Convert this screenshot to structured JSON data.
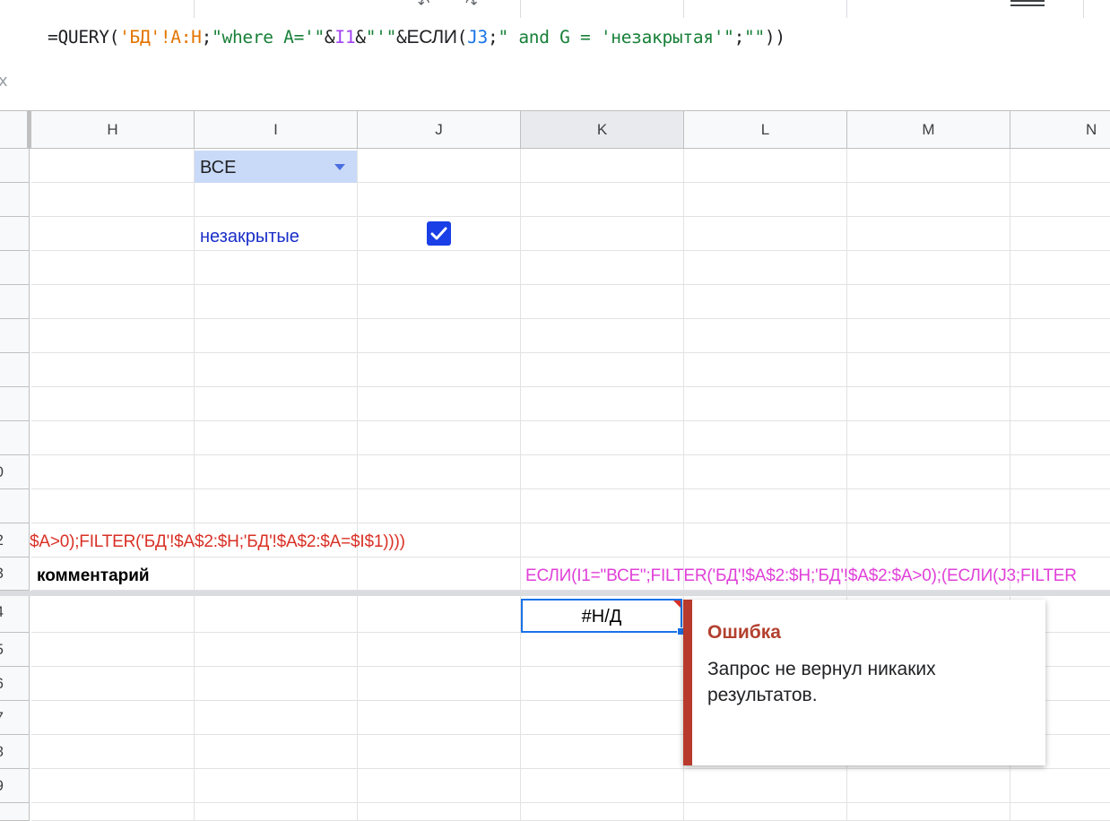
{
  "formula": {
    "prefix": "=QUERY(",
    "range": "'БД'!A:H",
    "sep1": ";",
    "str1": "\"where A='\"",
    "amp1": "&",
    "ref1": "I1",
    "amp2": "&",
    "str2": "\"'\"",
    "amp3": "&",
    "func": "ЕСЛИ",
    "paren": "(",
    "ref2": "J3",
    "sep2": ";",
    "str3": "\" and G = 'незакрытая'\"",
    "sep3": ";",
    "str4": "\"\"",
    "close": "))"
  },
  "fx_partial": "x",
  "columns": [
    "H",
    "I",
    "J",
    "K",
    "L",
    "M",
    "N"
  ],
  "rows": [
    "",
    "",
    "",
    "",
    "",
    "",
    "",
    "",
    "",
    "0",
    "",
    "2",
    "3",
    "4",
    "5",
    "6",
    "7",
    "8",
    "9",
    ""
  ],
  "cells": {
    "i1_dropdown": "ВСЕ",
    "i3_label": "незакрытые",
    "j3_checked": true,
    "row12_formula": "$A>0);FILTER('БД'!$A$2:$H;'БД'!$A$2:$A=$I$1))))",
    "h13_header": "комментарий",
    "k13_formula": "ЕСЛИ(I1=\"ВСЕ\";FILTER('БД'!$A$2:$H;'БД'!$A$2:$A>0);(ЕСЛИ(J3;FILTER",
    "k14_value": "#Н/Д"
  },
  "error_popup": {
    "title": "Ошибка",
    "message": "Запрос не вернул никаких результатов."
  },
  "colors": {
    "error_accent": "#b83a2c",
    "selection": "#1a73e8",
    "dropdown_bg": "#c9daf8",
    "checkbox": "#1a3fe6"
  }
}
